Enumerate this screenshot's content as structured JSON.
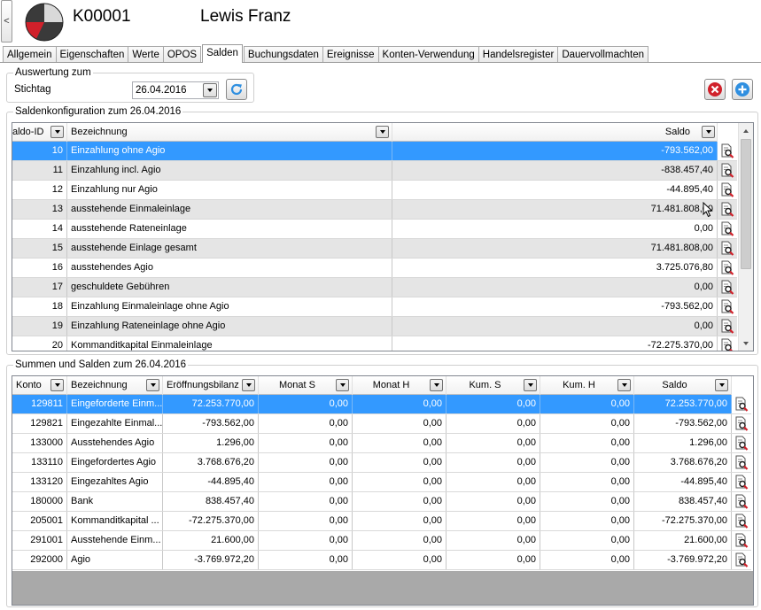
{
  "header": {
    "collapse_glyph": "<",
    "account_number": "K00001",
    "account_name": "Lewis Franz"
  },
  "tabs": [
    "Allgemein",
    "Eigenschaften",
    "Werte",
    "OPOS",
    "Salden",
    "Buchungsdaten",
    "Ereignisse",
    "Konten-Verwendung",
    "Handelsregister",
    "Dauervollmachten"
  ],
  "active_tab": "Salden",
  "evaluation": {
    "group_title": "Auswertung zum",
    "date_label": "Stichtag",
    "date_value": "26.04.2016"
  },
  "buttons": {
    "delete_icon": "delete-icon",
    "add_icon": "add-icon",
    "refresh_icon": "refresh-icon"
  },
  "colors": {
    "selection": "#3399ff",
    "alt_row": "#e5e5e5",
    "delete_red": "#d0202a",
    "add_blue": "#2f8fe0"
  },
  "balance_config": {
    "group_title": "Saldenkonfiguration zum 26.04.2016",
    "columns": {
      "id": "aldo-ID",
      "description": "Bezeichnung",
      "balance": "Saldo"
    },
    "rows": [
      {
        "id": "10",
        "description": "Einzahlung ohne Agio",
        "balance": "-793.562,00"
      },
      {
        "id": "11",
        "description": "Einzahlung incl. Agio",
        "balance": "-838.457,40"
      },
      {
        "id": "12",
        "description": "Einzahlung nur Agio",
        "balance": "-44.895,40"
      },
      {
        "id": "13",
        "description": "ausstehende Einmaleinlage",
        "balance": "71.481.808,00"
      },
      {
        "id": "14",
        "description": "ausstehende Rateneinlage",
        "balance": "0,00"
      },
      {
        "id": "15",
        "description": "ausstehende Einlage gesamt",
        "balance": "71.481.808,00"
      },
      {
        "id": "16",
        "description": "ausstehendes Agio",
        "balance": "3.725.076,80"
      },
      {
        "id": "17",
        "description": "geschuldete Gebühren",
        "balance": "0,00"
      },
      {
        "id": "18",
        "description": "Einzahlung Einmaleinlage ohne Agio",
        "balance": "-793.562,00"
      },
      {
        "id": "19",
        "description": "Einzahlung Rateneinlage ohne Agio",
        "balance": "0,00"
      },
      {
        "id": "20",
        "description": "Kommanditkapital Einmaleinlage",
        "balance": "-72.275.370,00"
      }
    ]
  },
  "totals": {
    "group_title": "Summen und Salden zum 26.04.2016",
    "columns": [
      "Konto",
      "Bezeichnung",
      "Eröffnungsbilanz",
      "Monat S",
      "Monat H",
      "Kum. S",
      "Kum. H",
      "Saldo"
    ],
    "rows": [
      [
        "129811",
        "Eingeforderte Einm...",
        "72.253.770,00",
        "0,00",
        "0,00",
        "0,00",
        "0,00",
        "72.253.770,00"
      ],
      [
        "129821",
        "Eingezahlte Einmal...",
        "-793.562,00",
        "0,00",
        "0,00",
        "0,00",
        "0,00",
        "-793.562,00"
      ],
      [
        "133000",
        "Ausstehendes Agio",
        "1.296,00",
        "0,00",
        "0,00",
        "0,00",
        "0,00",
        "1.296,00"
      ],
      [
        "133110",
        "Eingefordertes Agio",
        "3.768.676,20",
        "0,00",
        "0,00",
        "0,00",
        "0,00",
        "3.768.676,20"
      ],
      [
        "133120",
        "Eingezahltes Agio",
        "-44.895,40",
        "0,00",
        "0,00",
        "0,00",
        "0,00",
        "-44.895,40"
      ],
      [
        "180000",
        "Bank",
        "838.457,40",
        "0,00",
        "0,00",
        "0,00",
        "0,00",
        "838.457,40"
      ],
      [
        "205001",
        "Kommanditkapital ...",
        "-72.275.370,00",
        "0,00",
        "0,00",
        "0,00",
        "0,00",
        "-72.275.370,00"
      ],
      [
        "291001",
        "Ausstehende Einm...",
        "21.600,00",
        "0,00",
        "0,00",
        "0,00",
        "0,00",
        "21.600,00"
      ],
      [
        "292000",
        "Agio",
        "-3.769.972,20",
        "0,00",
        "0,00",
        "0,00",
        "0,00",
        "-3.769.972,20"
      ]
    ]
  }
}
